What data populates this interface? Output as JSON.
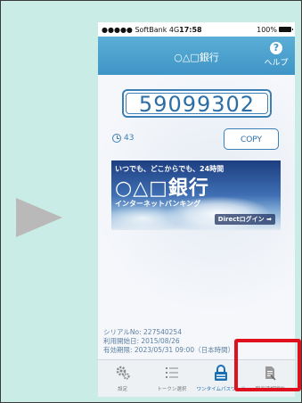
{
  "status_bar": {
    "carrier": "●●●●● SoftBank  4G",
    "time": "17:58",
    "battery": "100%"
  },
  "nav": {
    "title": "○△□銀行",
    "help_label": "ヘルプ",
    "help_glyph": "?"
  },
  "token": {
    "code": "59099302",
    "remaining_seconds": "43",
    "copy_label": "COPY"
  },
  "banner": {
    "tagline": "いつでも、どこからでも、24時間",
    "bank_name": "○△□銀行",
    "subtitle": "インターネットバンキング",
    "login_label": "Directログイン ➡"
  },
  "info": {
    "serial": "シリアルNo: 227540254",
    "start_date": "利用開始日: 2015/08/26",
    "expiry": "有効期限: 2023/05/31 09:00（日本時間）"
  },
  "tabs": [
    {
      "label": "設定",
      "icon": "gear-icon"
    },
    {
      "label": "トークン選択",
      "icon": "list-icon"
    },
    {
      "label": "ワンタイムパスワード",
      "icon": "lock-icon"
    },
    {
      "label": "取引確認開始",
      "icon": "document-icon"
    }
  ],
  "colors": {
    "accent": "#3f95c6",
    "highlight": "#e0111f",
    "background": "#c9ede6"
  }
}
